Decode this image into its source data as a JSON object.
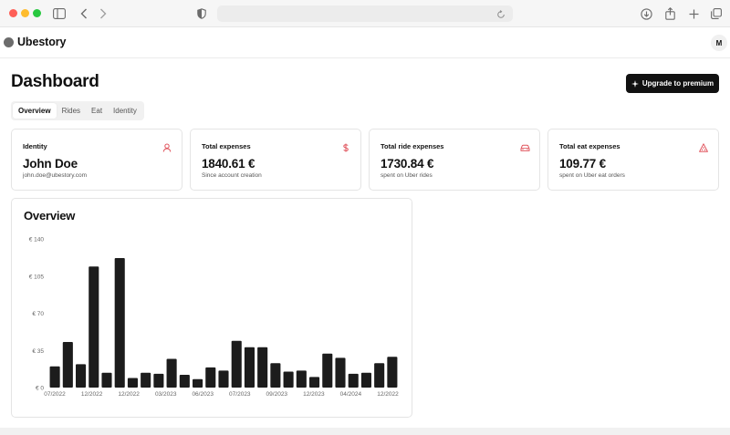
{
  "browser": {
    "icons": [
      "sidebar-icon",
      "back-icon",
      "forward-icon",
      "shield-icon",
      "reload-icon",
      "download-icon",
      "share-icon",
      "new-tab-icon",
      "tabs-icon"
    ]
  },
  "app": {
    "brand": "Ubestory",
    "avatar_initial": "M"
  },
  "page": {
    "title": "Dashboard",
    "upgrade_label": "Upgrade to premium"
  },
  "tabs": [
    {
      "label": "Overview",
      "active": true
    },
    {
      "label": "Rides",
      "active": false
    },
    {
      "label": "Eat",
      "active": false
    },
    {
      "label": "Identity",
      "active": false
    }
  ],
  "cards": [
    {
      "label": "Identity",
      "value": "John Doe",
      "sub": "john.doe@ubestory.com",
      "icon": "user-icon"
    },
    {
      "label": "Total expenses",
      "value": "1840.61 €",
      "sub": "Since account creation",
      "icon": "dollar-icon"
    },
    {
      "label": "Total ride expenses",
      "value": "1730.84 €",
      "sub": "spent on Uber rides",
      "icon": "car-icon"
    },
    {
      "label": "Total eat expenses",
      "value": "109.77 €",
      "sub": "spent on Uber eat orders",
      "icon": "pizza-icon"
    }
  ],
  "colors": {
    "accent": "#e0525b",
    "bar": "#1c1c1c",
    "button": "#111111"
  },
  "overview": {
    "title": "Overview"
  },
  "chart_data": {
    "type": "bar",
    "title": "Overview",
    "y_ticks": [
      "€ 0",
      "€ 35",
      "€ 70",
      "€ 105",
      "€ 140"
    ],
    "ylim": [
      0,
      140
    ],
    "x_tick_labels": [
      "07/2022",
      "12/2022",
      "12/2022",
      "03/2023",
      "06/2023",
      "07/2023",
      "09/2023",
      "12/2023",
      "04/2024",
      "12/2022"
    ],
    "values": [
      20,
      43,
      22,
      114,
      14,
      122,
      9,
      14,
      13,
      27,
      12,
      8,
      19,
      16,
      44,
      38,
      38,
      23,
      15,
      16,
      10,
      32,
      28,
      13,
      14,
      23,
      29
    ],
    "grid": false,
    "legend": "none"
  }
}
